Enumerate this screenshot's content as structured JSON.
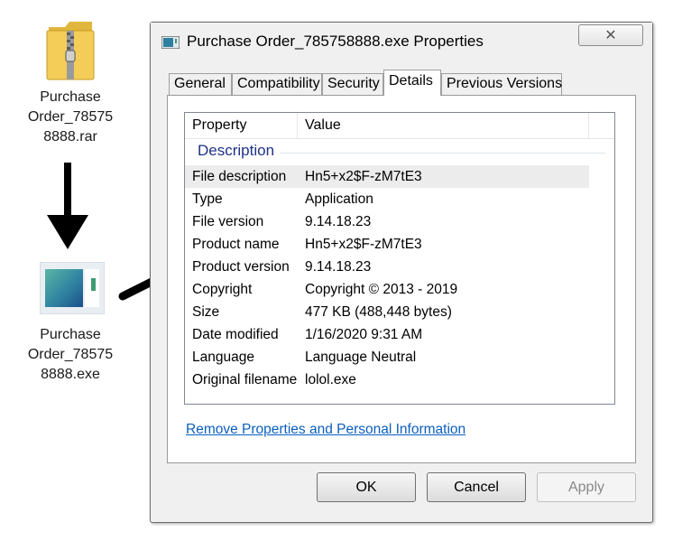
{
  "desktop": {
    "rar_icon_label": "Purchase Order_785758888.rar",
    "rar_label_lines": [
      "Purchase",
      "Order_78575",
      "8888.rar"
    ],
    "exe_label_lines": [
      "Purchase",
      "Order_78575",
      "8888.exe"
    ]
  },
  "dialog": {
    "title": "Purchase Order_785758888.exe Properties",
    "close_glyph": "✕",
    "tabs": [
      {
        "label": "General",
        "active": false
      },
      {
        "label": "Compatibility",
        "active": false
      },
      {
        "label": "Security",
        "active": false
      },
      {
        "label": "Details",
        "active": true
      },
      {
        "label": "Previous Versions",
        "active": false
      }
    ],
    "list": {
      "headers": [
        "Property",
        "Value"
      ],
      "group": "Description",
      "rows": [
        {
          "property": "File description",
          "value": "Hn5+x2$F-zM7tE3",
          "selected": true
        },
        {
          "property": "Type",
          "value": "Application"
        },
        {
          "property": "File version",
          "value": "9.14.18.23"
        },
        {
          "property": "Product name",
          "value": "Hn5+x2$F-zM7tE3"
        },
        {
          "property": "Product version",
          "value": "9.14.18.23"
        },
        {
          "property": "Copyright",
          "value": "Copyright © 2013 - 2019"
        },
        {
          "property": "Size",
          "value": "477 KB (488,448 bytes)"
        },
        {
          "property": "Date modified",
          "value": "1/16/2020 9:31 AM"
        },
        {
          "property": "Language",
          "value": "Language Neutral"
        },
        {
          "property": "Original filename",
          "value": "lolol.exe"
        }
      ]
    },
    "remove_link": "Remove Properties and Personal Information",
    "buttons": {
      "ok": "OK",
      "cancel": "Cancel",
      "apply": "Apply"
    }
  },
  "colors": {
    "link": "#0b5fbf",
    "group_header": "#1e3287",
    "selected_row": "#ececec"
  }
}
